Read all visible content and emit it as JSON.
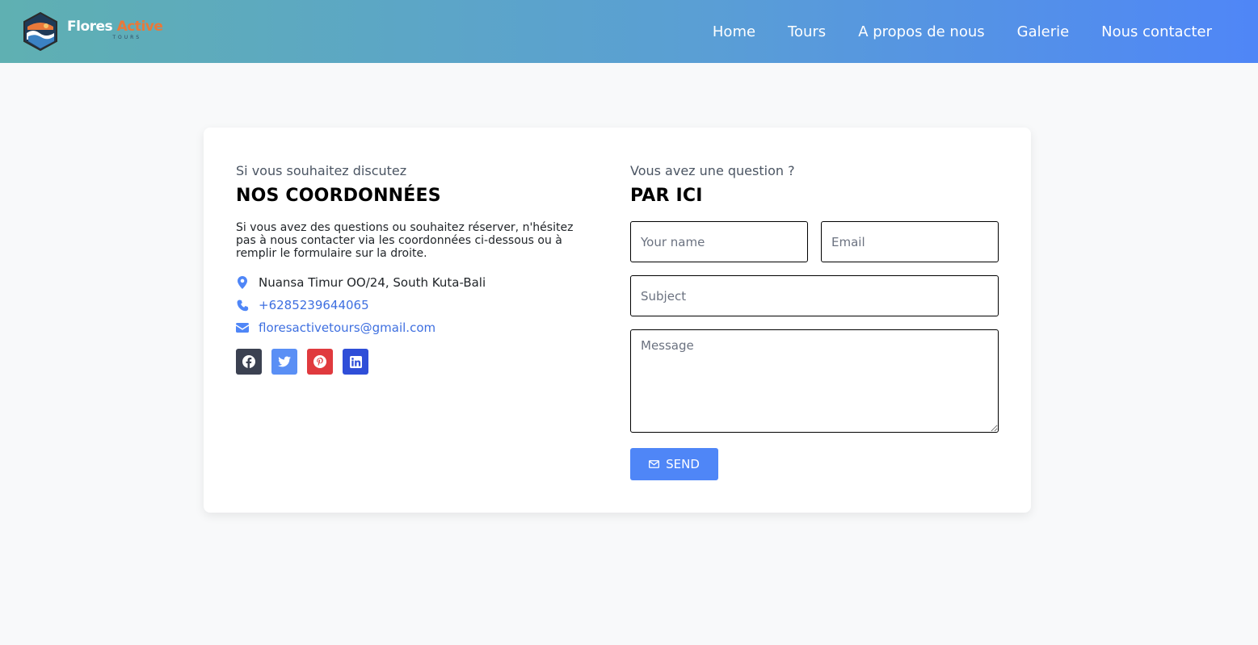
{
  "brand": {
    "name_part1": "Flores",
    "name_part2": "Active",
    "tagline": "TOURS"
  },
  "nav": {
    "items": [
      {
        "label": "Home"
      },
      {
        "label": "Tours"
      },
      {
        "label": "A propos de nous"
      },
      {
        "label": "Galerie"
      },
      {
        "label": "Nous contacter"
      }
    ]
  },
  "contact": {
    "eyebrow": "Si vous souhaitez discutez",
    "heading": "NOS COORDONNÉES",
    "description": "Si vous avez des questions ou souhaitez réserver, n'hésitez pas à nous contacter via les coordonnées ci-dessous ou à remplir le formulaire sur la droite.",
    "address": "Nuansa Timur OO/24, South Kuta-Bali",
    "phone": "+6285239644065",
    "email": "floresactivetours@gmail.com",
    "socials": [
      {
        "name": "facebook",
        "icon": "facebook-icon",
        "color": "#3b4151"
      },
      {
        "name": "twitter",
        "icon": "twitter-icon",
        "color": "#5a8ff5"
      },
      {
        "name": "pinterest",
        "icon": "pinterest-icon",
        "color": "#e03a3e"
      },
      {
        "name": "linkedin",
        "icon": "linkedin-icon",
        "color": "#2f4ed8"
      }
    ]
  },
  "form": {
    "eyebrow": "Vous avez une question ?",
    "heading": "PAR ICI",
    "name_placeholder": "Your name",
    "email_placeholder": "Email",
    "subject_placeholder": "Subject",
    "message_placeholder": "Message",
    "send_label": "SEND",
    "send_icon": "envelope-icon"
  },
  "colors": {
    "accent": "#4f86f7",
    "link": "#3e6fe0",
    "brand_orange": "#e8793a"
  }
}
